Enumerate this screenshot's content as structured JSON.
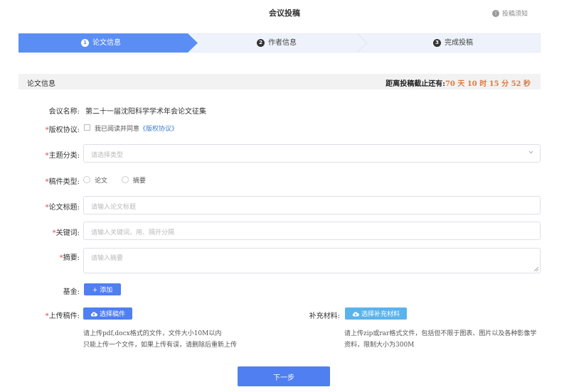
{
  "header": {
    "title": "会议投稿",
    "notice_label": "投稿须知"
  },
  "steps": [
    {
      "num": "1",
      "label": "论文信息"
    },
    {
      "num": "2",
      "label": "作者信息"
    },
    {
      "num": "3",
      "label": "完成投稿"
    }
  ],
  "colors": {
    "accent": "#4f7ff0",
    "step_active": "#5b8ef5",
    "step_inactive": "#eef3fb",
    "countdown": "#e07a3a",
    "required": "#e04b4b",
    "supplement_button": "#5cb3ec"
  },
  "section": {
    "title": "论文信息",
    "countdown_prefix": "距离投稿截止还有:",
    "countdown_value": "70 天 10 时 15 分 52 秒"
  },
  "form": {
    "conference_label": "会议名称:",
    "conference_value": "第二十一届沈阳科学学术年会论文征集",
    "copyright_label": "版权协议:",
    "copyright_agree": "我已阅读并同意",
    "copyright_link": "《版权协议》",
    "topic_label": "主题分类:",
    "topic_placeholder": "请选择类型",
    "type_label": "稿件类型:",
    "type_options": [
      "论文",
      "摘要"
    ],
    "title_label": "论文标题:",
    "title_placeholder": "请输入论文标题",
    "keywords_label": "关键词:",
    "keywords_placeholder": "请输入关键词，用、隔开分隔",
    "abstract_label": "摘要:",
    "abstract_placeholder": "请输入摘要",
    "fund_label": "基金:",
    "fund_button": "+ 添加",
    "upload_label": "上传稿件:",
    "upload_button": "选择稿件",
    "upload_hint_1": "请上传pdf,docx格式的文件，文件大小10M以内",
    "upload_hint_2": "只能上传一个文件，如果上传有误，请删除后重新上传",
    "supp_label": "补充材料:",
    "supp_button": "选择补充材料",
    "supp_hint_1": "请上传zip或rar格式文件，包括但不限于图表、图片以及各种影像学",
    "supp_hint_2": "资料，限制大小为300M",
    "required_mark": "*"
  },
  "footer": {
    "next_button": "下一步"
  },
  "icons": {
    "notice": "info-icon",
    "select": "chevron-down-icon",
    "upload": "cloud-upload-icon"
  }
}
